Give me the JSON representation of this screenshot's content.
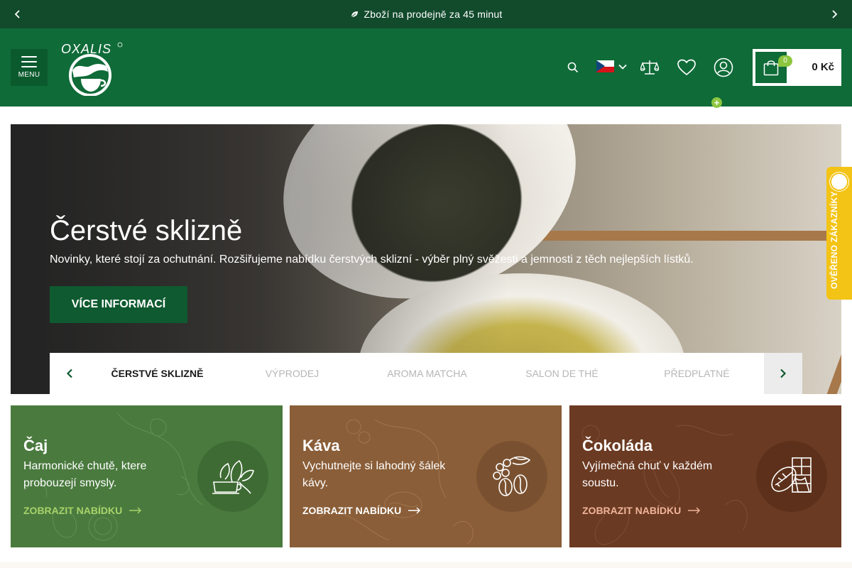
{
  "announcement": {
    "text": "Zboží na prodejně za 45 minut",
    "icon": "leaf-icon"
  },
  "header": {
    "menu_label": "MENU",
    "logo_text": "OXALIS",
    "language_flag": "cz-flag",
    "cart": {
      "count": "0",
      "total": "0 Kč"
    },
    "colors": {
      "primary": "#0f6b38",
      "dark": "#124a2c",
      "accent": "#8cc63f"
    }
  },
  "hero": {
    "title": "Čerstvé sklizně",
    "subtitle": "Novinky, které stojí za ochutnání. Rozšiřujeme nabídku čerstvých sklizní - výběr plný svěžesti a jemnosti z těch nejlepších lístků.",
    "cta_label": "VÍCE INFORMACÍ",
    "nav_items": [
      {
        "label": "ČERSTVÉ SKLIZNĚ ",
        "active": true
      },
      {
        "label": "VÝPRODEJ ",
        "active": false
      },
      {
        "label": "AROMA MATCHA ",
        "active": false
      },
      {
        "label": "SALON DE THÉ ",
        "active": false
      },
      {
        "label": "PŘEDPLATNÉ ",
        "active": false
      }
    ]
  },
  "verified_badge": {
    "label": "OVĚŘENO ZÁKAZNÍKY",
    "color": "#f3c316"
  },
  "categories": [
    {
      "title": "Čaj",
      "description": "Harmonické chutě, ktere probouzejí smysly.",
      "link_label": "ZOBRAZIT NABÍDKU",
      "icon": "tea-cup-icon",
      "bg_color": "#4a7a3e",
      "link_color": "#a7d36a"
    },
    {
      "title": "Káva",
      "description": "Vychutnejte si lahodný šálek kávy.",
      "link_label": "ZOBRAZIT NABÍDKU",
      "icon": "coffee-bean-icon",
      "bg_color": "#8a5e38",
      "link_color": "#ffffff"
    },
    {
      "title": "Čokoláda",
      "description": "Vyjímečná chuť v každém soustu.",
      "link_label": "ZOBRAZIT NABÍDKU",
      "icon": "chocolate-icon",
      "bg_color": "#6b3a22",
      "link_color": "#f0b49a"
    }
  ]
}
